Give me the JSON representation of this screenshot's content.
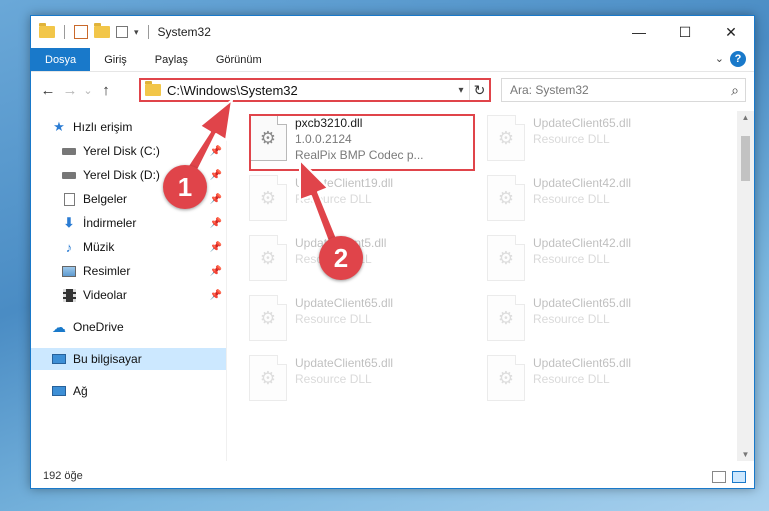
{
  "window": {
    "title": "System32",
    "quick_access_icons": [
      "folder-icon",
      "properties-icon",
      "new-folder-icon",
      "customize-icon"
    ]
  },
  "controls": {
    "minimize": "—",
    "maximize": "☐",
    "close": "✕"
  },
  "ribbon": {
    "tabs": [
      {
        "label": "Dosya",
        "active": true
      },
      {
        "label": "Giriş",
        "active": false
      },
      {
        "label": "Paylaş",
        "active": false
      },
      {
        "label": "Görünüm",
        "active": false
      }
    ],
    "help": "?"
  },
  "navigation": {
    "back": "←",
    "forward": "→",
    "recent": "⌄",
    "up": "↑",
    "address": "C:\\Windows\\System32",
    "search_placeholder": "Ara: System32"
  },
  "sidebar": {
    "items": [
      {
        "label": "Hızlı erişim",
        "icon": "star-icon",
        "pinned": false
      },
      {
        "label": "Yerel Disk (C:)",
        "icon": "drive-icon",
        "pinned": true
      },
      {
        "label": "Yerel Disk (D:)",
        "icon": "drive-icon",
        "pinned": true
      },
      {
        "label": "Belgeler",
        "icon": "documents-icon",
        "pinned": true
      },
      {
        "label": "İndirmeler",
        "icon": "downloads-icon",
        "pinned": true
      },
      {
        "label": "Müzik",
        "icon": "music-icon",
        "pinned": true
      },
      {
        "label": "Resimler",
        "icon": "pictures-icon",
        "pinned": true
      },
      {
        "label": "Videolar",
        "icon": "videos-icon",
        "pinned": true
      },
      {
        "label": "OneDrive",
        "icon": "cloud-icon",
        "pinned": false
      },
      {
        "label": "Bu bilgisayar",
        "icon": "computer-icon",
        "pinned": false,
        "selected": true
      },
      {
        "label": "Ağ",
        "icon": "network-icon",
        "pinned": false
      }
    ]
  },
  "files": {
    "left": [
      {
        "name": "pxcb3210.dll",
        "version": "1.0.0.2124",
        "description": "RealPix BMP Codec p...",
        "faded": false
      },
      {
        "name": "UpdateClient19.dll",
        "description": "Resource DLL",
        "faded": true
      },
      {
        "name": "UpdateClient5.dll",
        "description": "Resource DLL",
        "faded": true
      },
      {
        "name": "UpdateClient65.dll",
        "description": "Resource DLL",
        "faded": true
      },
      {
        "name": "UpdateClient65.dll",
        "description": "Resource DLL",
        "faded": true
      }
    ],
    "right": [
      {
        "name": "UpdateClient65.dll",
        "description": "Resource DLL",
        "faded": true
      },
      {
        "name": "UpdateClient42.dll",
        "description": "Resource DLL",
        "faded": true
      },
      {
        "name": "UpdateClient42.dll",
        "description": "Resource DLL",
        "faded": true
      },
      {
        "name": "UpdateClient65.dll",
        "description": "Resource DLL",
        "faded": true
      },
      {
        "name": "UpdateClient65.dll",
        "description": "Resource DLL",
        "faded": true
      }
    ]
  },
  "status": {
    "item_count": "192 öğe"
  },
  "annotations": {
    "step1": "1",
    "step2": "2",
    "color": "#e0444a"
  }
}
